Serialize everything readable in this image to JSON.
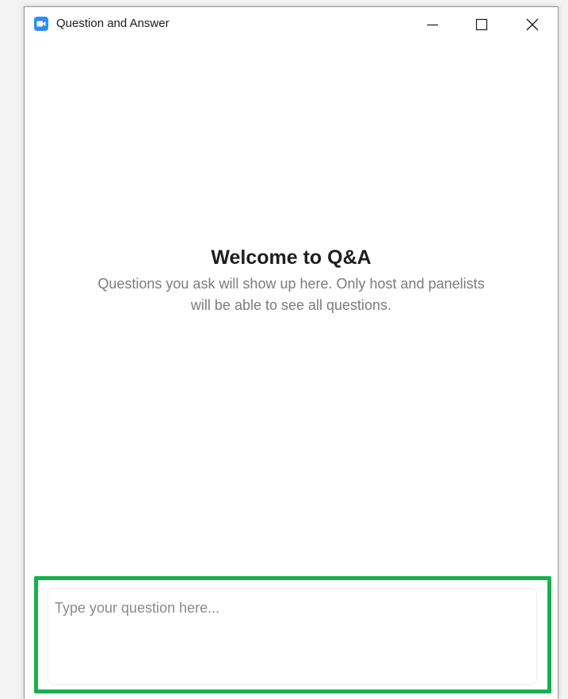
{
  "window": {
    "title": "Question and Answer",
    "app_icon": "zoom-camera-icon",
    "controls": {
      "minimize": "minimize-icon",
      "maximize": "maximize-icon",
      "close": "close-icon"
    }
  },
  "main": {
    "heading": "Welcome to Q&A",
    "description": "Questions you ask will show up here. Only host and panelists will be able to see all questions."
  },
  "composer": {
    "placeholder": "Type your question here...",
    "value": ""
  },
  "colors": {
    "highlight": "#17b14b",
    "app_icon": "#2d8cff",
    "description_text": "#7b7b80"
  }
}
